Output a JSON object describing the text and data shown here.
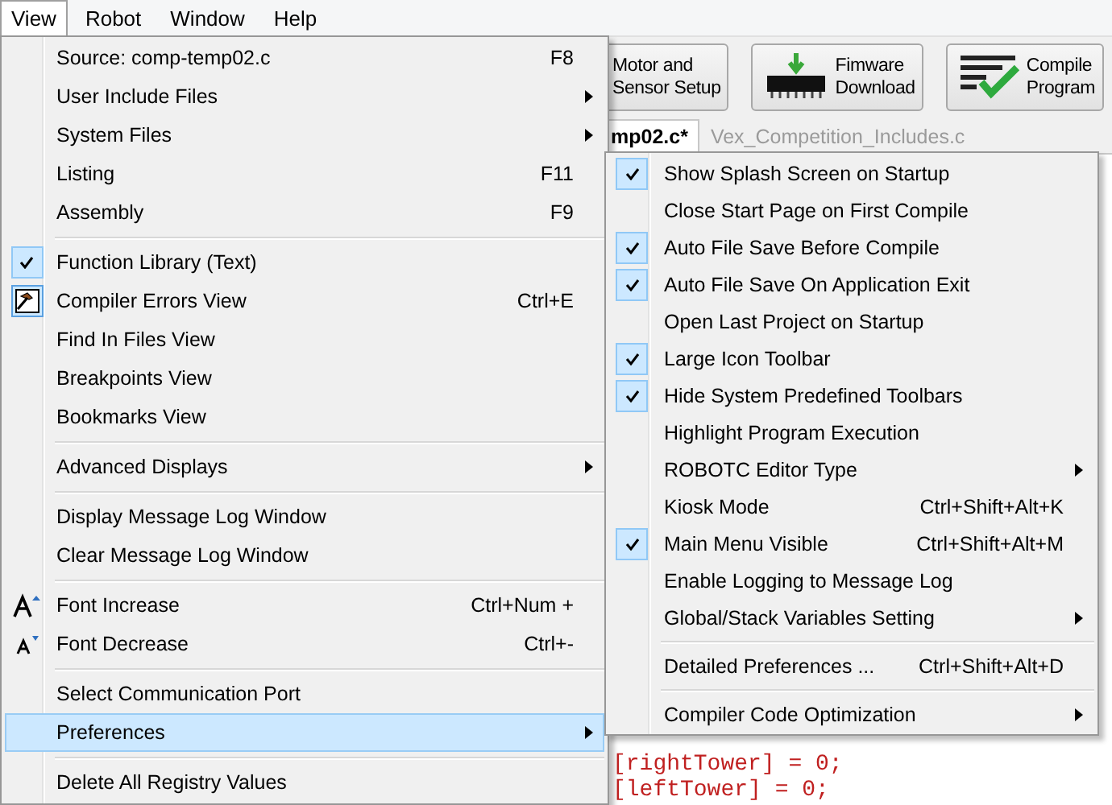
{
  "menubar": [
    {
      "label": "View",
      "selected": true
    },
    {
      "label": "Robot",
      "selected": false
    },
    {
      "label": "Window",
      "selected": false
    },
    {
      "label": "Help",
      "selected": false
    }
  ],
  "toolbar": {
    "buttons": [
      {
        "kind": "setup",
        "lines": [
          "Motor and",
          "Sensor Setup"
        ]
      },
      {
        "kind": "download",
        "lines": [
          "Fimware",
          "Download"
        ]
      },
      {
        "kind": "compile",
        "lines": [
          "Compile",
          "Program"
        ]
      }
    ]
  },
  "tabs": [
    {
      "label": "mp02.c*",
      "selected": true
    },
    {
      "label": "Vex_Competition_Includes.c",
      "selected": false
    }
  ],
  "editor": {
    "lines": [
      "[rightTower] = 0;",
      "[leftTower] = 0;"
    ]
  },
  "view_menu": {
    "items": [
      {
        "kind": "item",
        "label": "Source: comp-temp02.c",
        "shortcut": "F8",
        "submenu": false,
        "checked": false,
        "selected": false
      },
      {
        "kind": "item",
        "label": "User Include Files",
        "submenu": true,
        "checked": false,
        "selected": false
      },
      {
        "kind": "item",
        "label": "System Files",
        "submenu": true,
        "checked": false,
        "selected": false
      },
      {
        "kind": "item",
        "label": "Listing",
        "shortcut": "F11",
        "submenu": false,
        "checked": false,
        "selected": false
      },
      {
        "kind": "item",
        "label": "Assembly",
        "shortcut": "F9",
        "submenu": false,
        "checked": false,
        "selected": false
      },
      {
        "kind": "separator"
      },
      {
        "kind": "item",
        "label": "Function Library (Text)",
        "submenu": false,
        "checked": true,
        "selected": false
      },
      {
        "kind": "errors-tool",
        "label": "Compiler Errors View",
        "shortcut": "Ctrl+E",
        "submenu": false,
        "checked": false,
        "selected": false
      },
      {
        "kind": "item",
        "label": "Find In Files View",
        "submenu": false,
        "checked": false,
        "selected": false
      },
      {
        "kind": "item",
        "label": "Breakpoints View",
        "submenu": false,
        "checked": false,
        "selected": false
      },
      {
        "kind": "item",
        "label": "Bookmarks View",
        "submenu": false,
        "checked": false,
        "selected": false
      },
      {
        "kind": "separator"
      },
      {
        "kind": "item",
        "label": "Advanced Displays",
        "submenu": true,
        "checked": false,
        "selected": false
      },
      {
        "kind": "separator"
      },
      {
        "kind": "item",
        "label": "Display Message Log Window",
        "submenu": false,
        "checked": false,
        "selected": false
      },
      {
        "kind": "item",
        "label": "Clear Message Log Window",
        "submenu": false,
        "checked": false,
        "selected": false
      },
      {
        "kind": "separator"
      },
      {
        "kind": "grow-font",
        "label": "Font Increase",
        "shortcut": "Ctrl+Num +",
        "submenu": false,
        "checked": false,
        "selected": false
      },
      {
        "kind": "shrink-font",
        "label": "Font Decrease",
        "shortcut": "Ctrl+-",
        "submenu": false,
        "checked": false,
        "selected": false
      },
      {
        "kind": "separator"
      },
      {
        "kind": "item",
        "label": "Select Communication Port",
        "submenu": false,
        "checked": false,
        "selected": false
      },
      {
        "kind": "item",
        "label": "Preferences",
        "submenu": true,
        "checked": false,
        "selected": true
      },
      {
        "kind": "separator"
      },
      {
        "kind": "item",
        "label": "Delete All Registry Values",
        "submenu": false,
        "checked": false,
        "selected": false
      }
    ]
  },
  "preferences_menu": {
    "items": [
      {
        "kind": "item",
        "label": "Show Splash Screen on Startup",
        "submenu": false,
        "checked": true,
        "selected": false
      },
      {
        "kind": "item",
        "label": "Close Start Page on First Compile",
        "submenu": false,
        "checked": false,
        "selected": false
      },
      {
        "kind": "item",
        "label": "Auto File Save Before Compile",
        "submenu": false,
        "checked": true,
        "selected": false
      },
      {
        "kind": "item",
        "label": "Auto File Save On Application Exit",
        "submenu": false,
        "checked": true,
        "selected": false
      },
      {
        "kind": "item",
        "label": "Open Last Project on Startup",
        "submenu": false,
        "checked": false,
        "selected": false
      },
      {
        "kind": "item",
        "label": "Large Icon Toolbar",
        "submenu": false,
        "checked": true,
        "selected": false
      },
      {
        "kind": "item",
        "label": "Hide System Predefined Toolbars",
        "submenu": false,
        "checked": true,
        "selected": false
      },
      {
        "kind": "item",
        "label": "Highlight Program Execution",
        "submenu": false,
        "checked": false,
        "selected": false
      },
      {
        "kind": "item",
        "label": "ROBOTC Editor Type",
        "submenu": true,
        "checked": false,
        "selected": false
      },
      {
        "kind": "item",
        "label": "Kiosk Mode",
        "shortcut": "Ctrl+Shift+Alt+K",
        "submenu": false,
        "checked": false,
        "selected": false
      },
      {
        "kind": "item",
        "label": "Main Menu Visible",
        "shortcut": "Ctrl+Shift+Alt+M",
        "submenu": false,
        "checked": true,
        "selected": false
      },
      {
        "kind": "item",
        "label": "Enable Logging to Message Log",
        "submenu": false,
        "checked": false,
        "selected": false
      },
      {
        "kind": "item",
        "label": "Global/Stack Variables Setting",
        "submenu": true,
        "checked": false,
        "selected": false
      },
      {
        "kind": "separator"
      },
      {
        "kind": "item",
        "label": "Detailed Preferences ...",
        "shortcut": "Ctrl+Shift+Alt+D",
        "submenu": false,
        "checked": false,
        "selected": false
      },
      {
        "kind": "separator"
      },
      {
        "kind": "item",
        "label": "Compiler Code Optimization",
        "submenu": true,
        "checked": false,
        "selected": false
      }
    ]
  }
}
